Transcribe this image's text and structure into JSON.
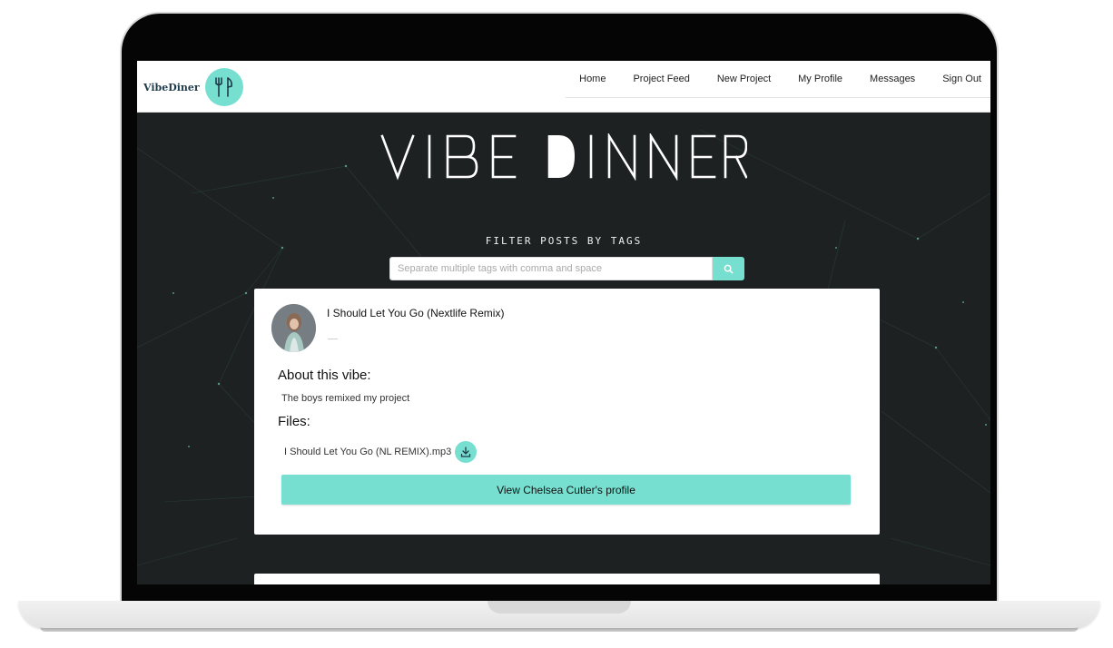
{
  "navbar": {
    "brand": "VibeDiner",
    "links": [
      "Home",
      "Project Feed",
      "New Project",
      "My Profile",
      "Messages",
      "Sign Out"
    ]
  },
  "hero": {
    "title": "VIBEDINER"
  },
  "filter": {
    "label": "FILTER POSTS BY TAGS",
    "placeholder": "Separate multiple tags with comma and space"
  },
  "post": {
    "title": "I Should Let You Go (Nextlife Remix)",
    "about_heading": "About this vibe:",
    "about_text": "The boys remixed my project",
    "files_heading": "Files:",
    "file_name": "I Should Let You Go (NL REMIX).mp3",
    "profile_button": "View Chelsea Cutler's profile"
  },
  "colors": {
    "accent": "#76dfd0",
    "background": "#1e2122",
    "navbar": "#ffffff"
  },
  "icons": {
    "brand_logo": "fork-knife-icon",
    "search": "search-icon",
    "download": "download-icon"
  }
}
